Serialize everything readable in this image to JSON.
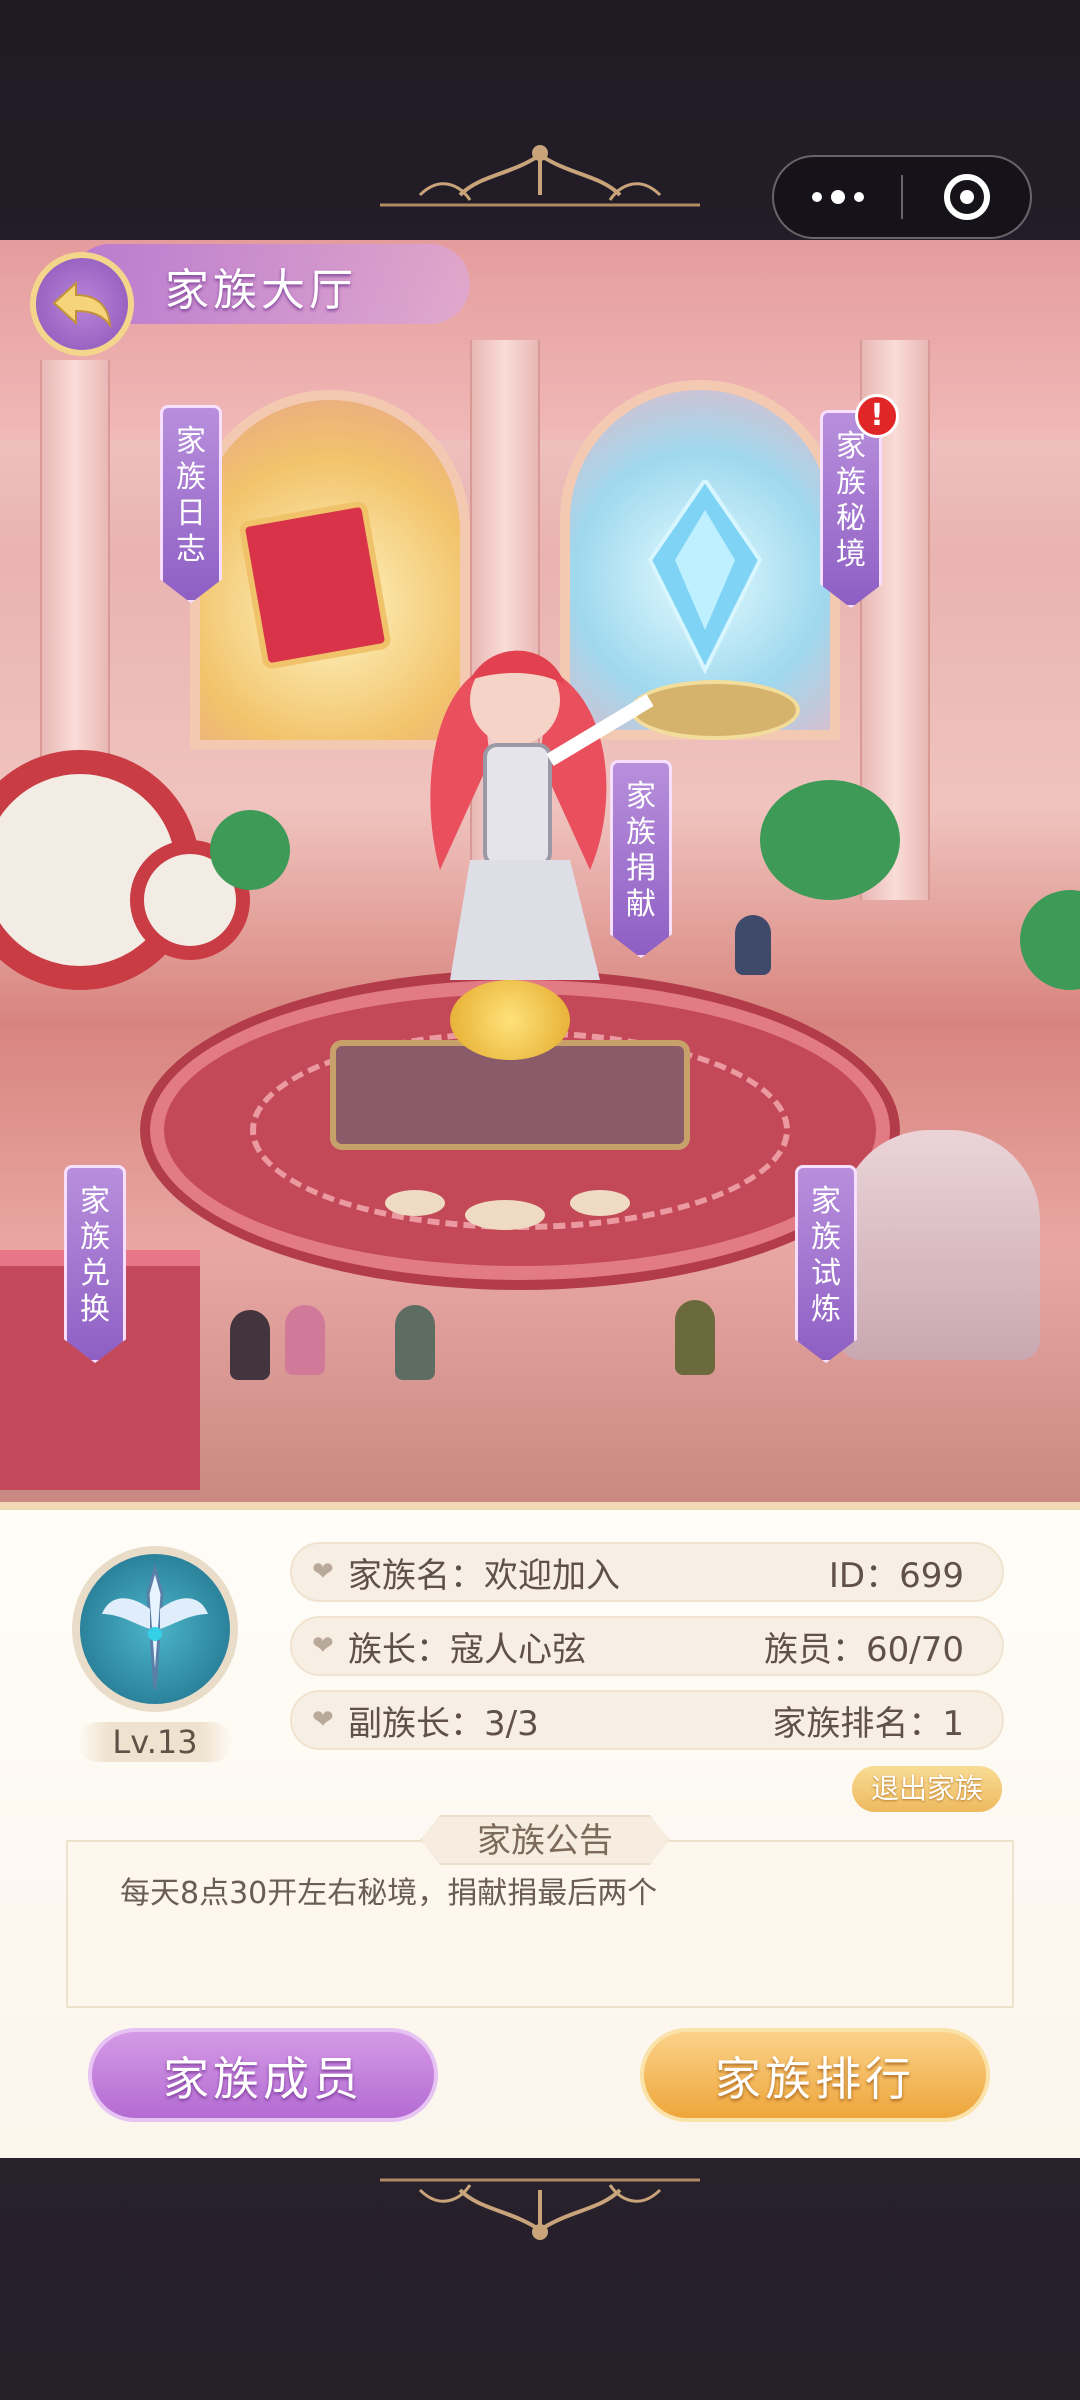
{
  "capsule": {
    "more_icon": "ellipsis-icon",
    "close_icon": "target-circle-icon"
  },
  "header": {
    "title": "家族大厅",
    "back_icon": "back-arrow-icon"
  },
  "scene_banners": {
    "log": "家族日志",
    "secret": "家族秘境",
    "donate": "家族捐献",
    "exchange": "家族兑换",
    "trial": "家族试炼",
    "secret_alert": "!"
  },
  "info": {
    "level": "Lv.13",
    "family_name": "家族名：欢迎加入",
    "id": "ID：699",
    "leader": "族长：寇人心弦",
    "members": "族员：60/70",
    "vice_leader": "副族长：3/3",
    "rank": "家族排名：1",
    "quit_label": "退出家族"
  },
  "notice": {
    "title": "家族公告",
    "text": "每天8点30开左右秘境，捐献捐最后两个"
  },
  "buttons": {
    "members": "家族成员",
    "ranking": "家族排行"
  },
  "colors": {
    "accent_purple": "#b46bd2",
    "accent_gold": "#eea63b",
    "alert_red": "#e02626"
  }
}
